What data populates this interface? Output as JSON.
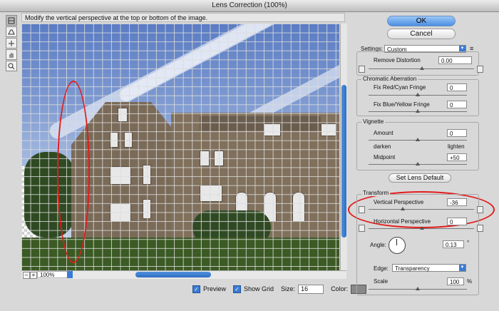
{
  "window": {
    "title": "Lens Correction (100%)"
  },
  "hint": "Modify the vertical perspective at the top or bottom of the image.",
  "tools": [
    "remove-distortion-tool-icon",
    "straighten-tool-icon",
    "move-grid-tool-icon",
    "hand-tool-icon",
    "zoom-tool-icon"
  ],
  "preview": {
    "zoom": "100%",
    "zoom_minus": "−",
    "zoom_plus": "+"
  },
  "bottom": {
    "preview_label": "Preview",
    "show_grid_label": "Show Grid",
    "size_label": "Size:",
    "size_value": "16",
    "color_label": "Color:",
    "grid_color": "#888888",
    "check": "✓"
  },
  "buttons": {
    "ok": "OK",
    "cancel": "Cancel"
  },
  "settings": {
    "label": "Settings:",
    "value": "Custom",
    "menu_icon": "≡"
  },
  "remove_distortion": {
    "label": "Remove Distortion",
    "value": "0.00"
  },
  "chromatic": {
    "title": "Chromatic Aberration",
    "red_cyan_label": "Fix Red/Cyan Fringe",
    "red_cyan_value": "0",
    "blue_yellow_label": "Fix Blue/Yellow Fringe",
    "blue_yellow_value": "0"
  },
  "vignette": {
    "title": "Vignette",
    "amount_label": "Amount",
    "amount_value": "0",
    "darken": "darken",
    "lighten": "lighten",
    "midpoint_label": "Midpoint",
    "midpoint_value": "+50"
  },
  "lens_default": "Set Lens Default",
  "transform": {
    "title": "Transform",
    "vertical_label": "Vertical Perspective",
    "vertical_value": "-36",
    "horizontal_label": "Horizontal Perspective",
    "horizontal_value": "0",
    "angle_label": "Angle:",
    "angle_value": "0.13",
    "degree": "°"
  },
  "edge": {
    "label": "Edge:",
    "value": "Transparency"
  },
  "scale": {
    "label": "Scale",
    "value": "100",
    "unit": "%"
  },
  "colors": {
    "accent": "#3a7bd5",
    "annotation": "#e21c1c"
  }
}
